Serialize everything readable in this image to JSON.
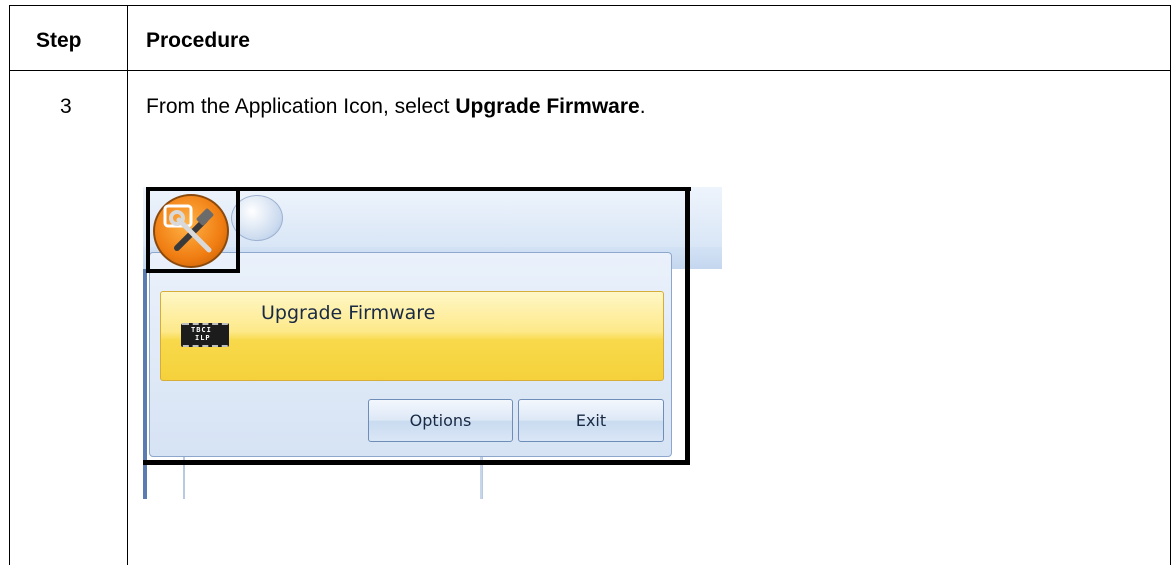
{
  "table": {
    "header_step": "Step",
    "header_procedure": "Procedure",
    "row": {
      "step_number": "3",
      "instruction_prefix": "From the Application Icon, select ",
      "instruction_bold": "Upgrade Firmware",
      "instruction_suffix": "."
    }
  },
  "screenshot": {
    "menu_item_label": "Upgrade Firmware",
    "chip_text_line1": "TBCI",
    "chip_text_line2": "ILP",
    "options_button": "Options",
    "exit_button": "Exit"
  },
  "colors": {
    "menu_highlight": "#f8d94a",
    "app_icon_orange": "#f07d12",
    "ribbon_blue": "#d9e6f6"
  },
  "icons": {
    "app_icon": "application-icon-tools",
    "menu_item_icon": "firmware-chip-icon"
  }
}
